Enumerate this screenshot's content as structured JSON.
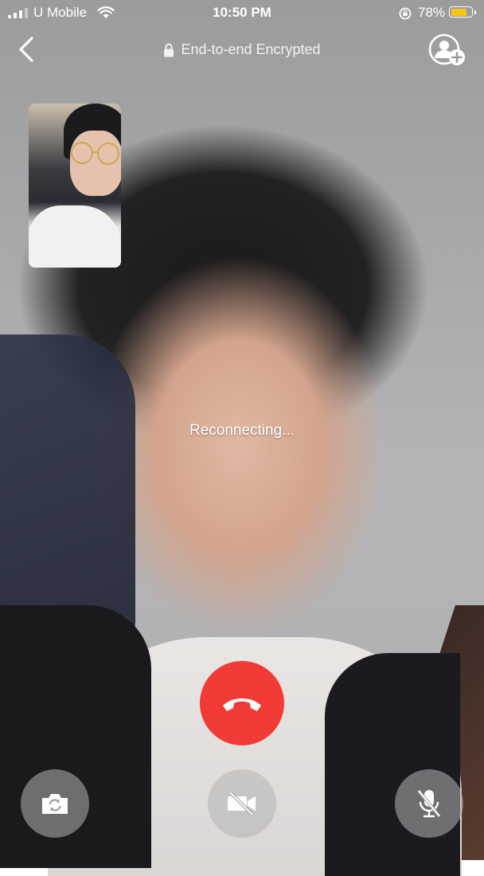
{
  "status_bar": {
    "carrier": "U Mobile",
    "time": "10:50 PM",
    "battery_percent": "78%",
    "battery_level": 0.78,
    "battery_color": "#f6c417"
  },
  "header": {
    "encrypted_label": "End-to-end Encrypted",
    "icons": [
      "back-icon",
      "lock-icon",
      "add-participant-icon"
    ]
  },
  "call": {
    "status_text": "Reconnecting...",
    "end_call_color": "#f23b37",
    "controls": [
      "switch-camera-icon",
      "video-off-icon",
      "mic-muted-icon"
    ]
  }
}
